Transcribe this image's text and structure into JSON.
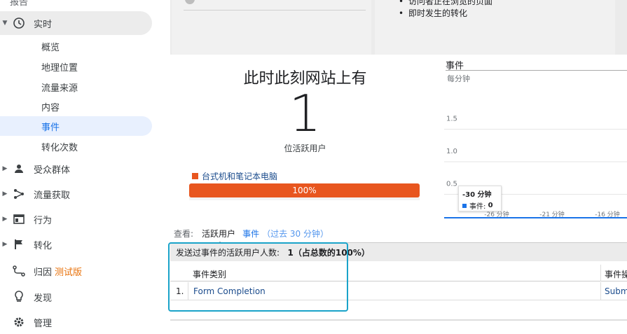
{
  "sidebar": {
    "section_label": "报告",
    "realtime": "实时",
    "realtime_sub": [
      "概览",
      "地理位置",
      "流量来源",
      "内容",
      "事件",
      "转化次数"
    ],
    "active_sub": "事件",
    "items": [
      {
        "label": "受众群体",
        "icon": "person-icon"
      },
      {
        "label": "流量获取",
        "icon": "acquisition-icon"
      },
      {
        "label": "行为",
        "icon": "behavior-icon"
      },
      {
        "label": "转化",
        "icon": "flag-icon"
      }
    ],
    "attribution": "归因",
    "attribution_badge": "测试版",
    "discover": "发现",
    "admin": "管理"
  },
  "top_panel": {
    "bullets": [
      "访问者正在浏览的页面",
      "即时发生的转化"
    ]
  },
  "realtime_summary": {
    "headline": "此时此刻网站上有",
    "active_users": "1",
    "active_users_label": "位活跃用户",
    "device_label": "台式机和笔记本电脑",
    "device_percent": 100,
    "device_percent_label": "100%",
    "device_color": "#e8561f"
  },
  "chart_data": {
    "type": "line",
    "title": "事件",
    "subtitle": "每分钟",
    "y_ticks": [
      "1.5",
      "1.0",
      "0.5"
    ],
    "x_ticks": [
      "-26 分钟",
      "-21 分钟",
      "-16 分钟"
    ],
    "series": [
      {
        "name": "事件",
        "color": "#1a73e8",
        "values": [
          0,
          0,
          0,
          0,
          0,
          0,
          0,
          0,
          0,
          0,
          0,
          0,
          0,
          0,
          0
        ]
      }
    ],
    "ylim": [
      0,
      2
    ],
    "tooltip": {
      "title": "-30 分钟",
      "series_label": "事件:",
      "value": "0"
    }
  },
  "view_tabs": {
    "label": "查看:",
    "active_tab": "活跃用户",
    "tab_events": "事件",
    "tab_events_note": "（过去 30 分钟）"
  },
  "table": {
    "summary_prefix": "发送过事件的活跃用户人数:",
    "summary_value": "1（占总数的100%）",
    "col_category": "事件类别",
    "col_action": "事件操",
    "rows": [
      {
        "index": "1.",
        "category": "Form Completion",
        "action": "Submi"
      }
    ]
  }
}
